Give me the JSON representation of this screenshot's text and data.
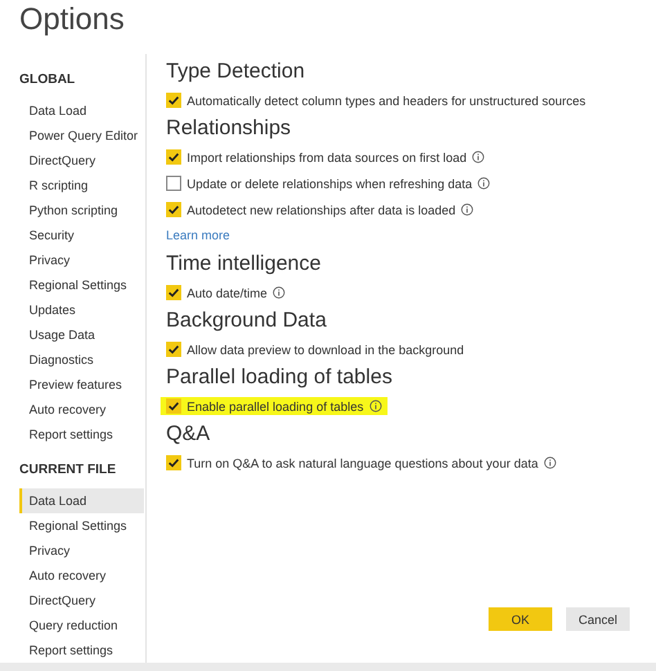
{
  "window": {
    "title": "Options"
  },
  "sidebar": {
    "sections": [
      {
        "heading": "GLOBAL",
        "items": [
          {
            "label": "Data Load",
            "selected": false
          },
          {
            "label": "Power Query Editor",
            "selected": false
          },
          {
            "label": "DirectQuery",
            "selected": false
          },
          {
            "label": "R scripting",
            "selected": false
          },
          {
            "label": "Python scripting",
            "selected": false
          },
          {
            "label": "Security",
            "selected": false
          },
          {
            "label": "Privacy",
            "selected": false
          },
          {
            "label": "Regional Settings",
            "selected": false
          },
          {
            "label": "Updates",
            "selected": false
          },
          {
            "label": "Usage Data",
            "selected": false
          },
          {
            "label": "Diagnostics",
            "selected": false
          },
          {
            "label": "Preview features",
            "selected": false
          },
          {
            "label": "Auto recovery",
            "selected": false
          },
          {
            "label": "Report settings",
            "selected": false
          }
        ]
      },
      {
        "heading": "CURRENT FILE",
        "items": [
          {
            "label": "Data Load",
            "selected": true
          },
          {
            "label": "Regional Settings",
            "selected": false
          },
          {
            "label": "Privacy",
            "selected": false
          },
          {
            "label": "Auto recovery",
            "selected": false
          },
          {
            "label": "DirectQuery",
            "selected": false
          },
          {
            "label": "Query reduction",
            "selected": false
          },
          {
            "label": "Report settings",
            "selected": false
          }
        ]
      }
    ]
  },
  "sections": [
    {
      "heading": "Type Detection",
      "options": [
        {
          "label": "Automatically detect column types and headers for unstructured sources",
          "checked": true,
          "info": false,
          "highlighted": false
        }
      ]
    },
    {
      "heading": "Relationships",
      "options": [
        {
          "label": "Import relationships from data sources on first load",
          "checked": true,
          "info": true,
          "highlighted": false
        },
        {
          "label": "Update or delete relationships when refreshing data",
          "checked": false,
          "info": true,
          "highlighted": false
        },
        {
          "label": "Autodetect new relationships after data is loaded",
          "checked": true,
          "info": true,
          "highlighted": false
        }
      ],
      "link": "Learn more"
    },
    {
      "heading": "Time intelligence",
      "options": [
        {
          "label": "Auto date/time",
          "checked": true,
          "info": true,
          "highlighted": false
        }
      ]
    },
    {
      "heading": "Background Data",
      "options": [
        {
          "label": "Allow data preview to download in the background",
          "checked": true,
          "info": false,
          "highlighted": false
        }
      ]
    },
    {
      "heading": "Parallel loading of tables",
      "options": [
        {
          "label": "Enable parallel loading of tables",
          "checked": true,
          "info": true,
          "highlighted": true
        }
      ]
    },
    {
      "heading": "Q&A",
      "options": [
        {
          "label": "Turn on Q&A to ask natural language questions about your data",
          "checked": true,
          "info": true,
          "highlighted": false
        }
      ]
    }
  ],
  "buttons": [
    {
      "label": "OK",
      "kind": "primary"
    },
    {
      "label": "Cancel",
      "kind": "secondary"
    }
  ]
}
